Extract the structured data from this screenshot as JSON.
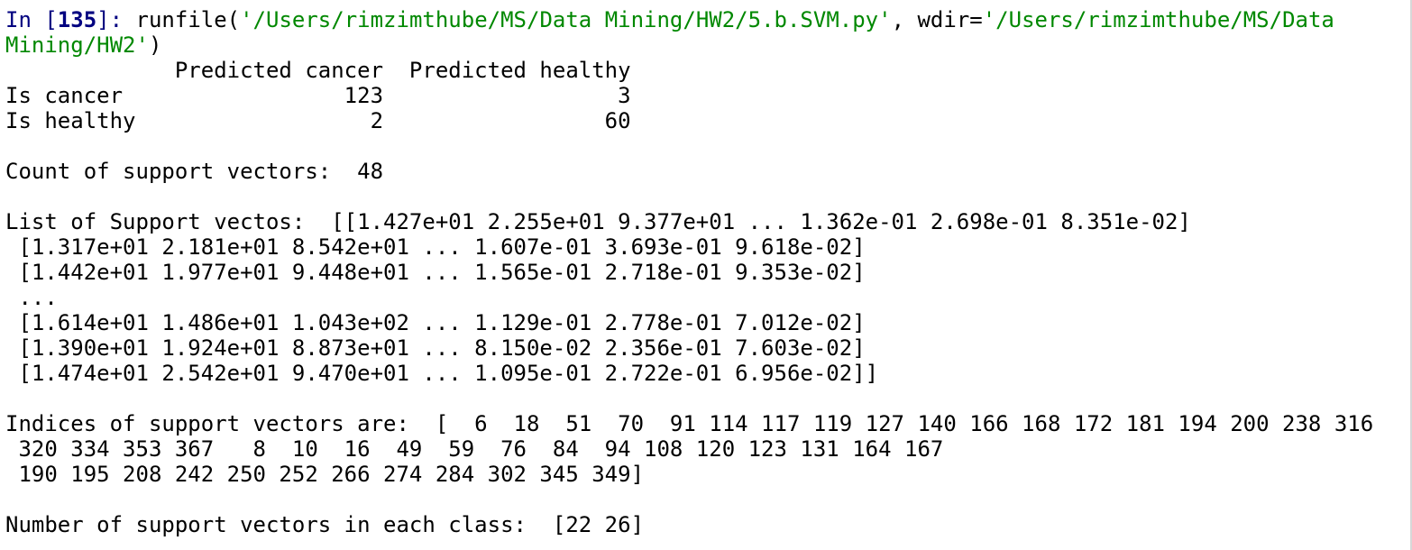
{
  "prompt": {
    "prefix": "In [",
    "number": "135",
    "suffix": "]: "
  },
  "command": {
    "func": "runfile(",
    "arg1": "'/Users/rimzimthube/MS/Data Mining/HW2/5.b.SVM.py'",
    "sep": ", wdir=",
    "arg2_part1": "'/Users/rimzimthube/MS/Data",
    "arg2_part2": "Mining/HW2'",
    "close": ")"
  },
  "confusion_matrix": {
    "header": "             Predicted cancer  Predicted healthy",
    "rows": [
      "Is cancer                 123                  3",
      "Is healthy                  2                 60"
    ]
  },
  "count_line": "Count of support vectors:  48",
  "support_vectors": {
    "lines": [
      "List of Support vectos:  [[1.427e+01 2.255e+01 9.377e+01 ... 1.362e-01 2.698e-01 8.351e-02]",
      " [1.317e+01 2.181e+01 8.542e+01 ... 1.607e-01 3.693e-01 9.618e-02]",
      " [1.442e+01 1.977e+01 9.448e+01 ... 1.565e-01 2.718e-01 9.353e-02]",
      " ...",
      " [1.614e+01 1.486e+01 1.043e+02 ... 1.129e-01 2.778e-01 7.012e-02]",
      " [1.390e+01 1.924e+01 8.873e+01 ... 8.150e-02 2.356e-01 7.603e-02]",
      " [1.474e+01 2.542e+01 9.470e+01 ... 1.095e-01 2.722e-01 6.956e-02]]"
    ]
  },
  "indices": {
    "lines": [
      "Indices of support vectors are:  [  6  18  51  70  91 114 117 119 127 140 166 168 172 181 194 200 238 316",
      " 320 334 353 367   8  10  16  49  59  76  84  94 108 120 123 131 164 167",
      " 190 195 208 242 250 252 266 274 284 302 345 349]"
    ]
  },
  "class_counts_line": "Number of support vectors in each class:  [22 26]",
  "colors": {
    "prompt": "#000080",
    "string": "#008800",
    "text": "#000000",
    "background": "#ffffff"
  }
}
